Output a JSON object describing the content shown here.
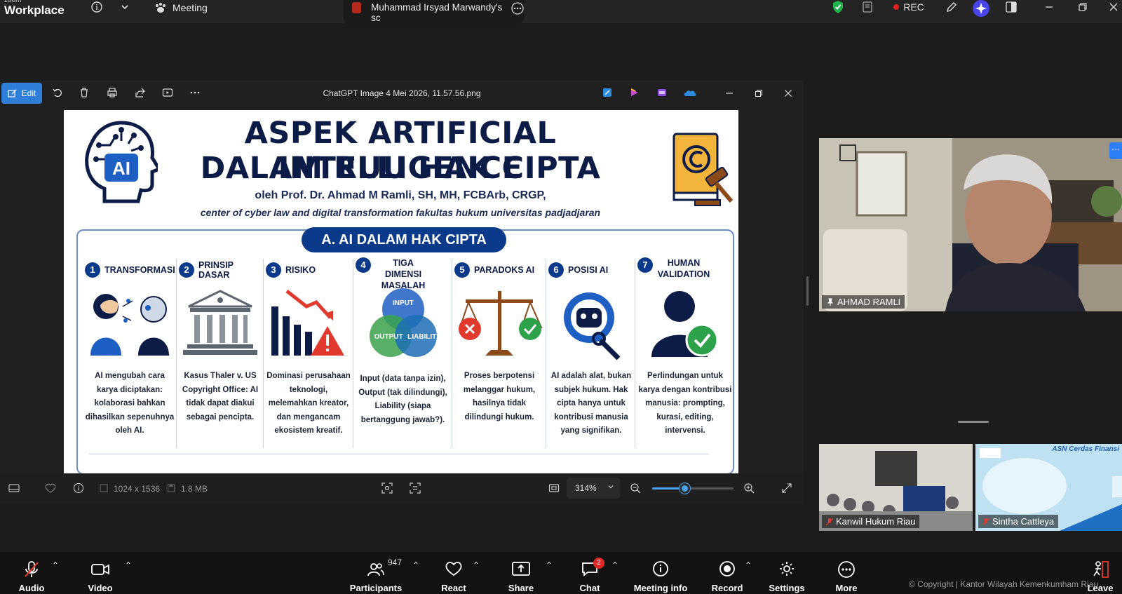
{
  "app": {
    "brand_small": "zoom",
    "brand_large": "Workplace"
  },
  "tabs": {
    "meeting": "Meeting",
    "share": "Muhammad Irsyad Marwandy's sc"
  },
  "status": {
    "rec": "REC"
  },
  "viewer": {
    "edit_label": "Edit",
    "file_title": "ChatGPT Image 4 Mei 2026, 11.57.56.png",
    "dimensions": "1024 x 1536",
    "file_size": "1.8 MB",
    "zoom": "314%",
    "zoom_slider_fraction": 0.4
  },
  "slide": {
    "title_line1": "ASPEK ARTIFICIAL INTELLIGENCE",
    "title_line2": "DALAM RUU HAK CIPTA",
    "ai_badge": "AI",
    "byline": "oleh Prof. Dr. Ahmad M Ramli, SH, MH, FCBArb, CRGP,",
    "affiliation": "center of cyber law and digital transformation fakultas hukum universitas padjadjaran",
    "section": "A. AI DALAM HAK CIPTA",
    "venn": {
      "top": "INPUT",
      "left": "OUTPUT",
      "right": "LIABILITY"
    },
    "columns": [
      {
        "num": "1",
        "title": "TRANSFORMASI",
        "body": "AI mengubah cara karya diciptakan: kolaborasi bahkan dihasilkan sepenuhnya oleh AI."
      },
      {
        "num": "2",
        "title": "PRINSIP DASAR",
        "body": "Kasus Thaler v. US Copyright Office: AI tidak dapat diakui sebagai pencipta."
      },
      {
        "num": "3",
        "title": "RISIKO",
        "body": "Dominasi perusahaan teknologi, melemahkan kreator, dan mengancam ekosistem kreatif."
      },
      {
        "num": "4",
        "title": "TIGA DIMENSI MASALAH",
        "body": "Input (data tanpa izin), Output (tak dilindungi), Liability (siapa bertanggung jawab?)."
      },
      {
        "num": "5",
        "title": "PARADOKS AI",
        "body": "Proses berpotensi melanggar hukum, hasilnya tidak dilindungi hukum."
      },
      {
        "num": "6",
        "title": "POSISI AI",
        "body": "AI adalah alat, bukan subjek hukum. Hak cipta hanya untuk kontribusi manusia yang signifikan."
      },
      {
        "num": "7",
        "title": "HUMAN VALIDATION",
        "body": "Perlindungan untuk karya dengan kontribusi manusia: prompting, kurasi, editing, intervensi."
      }
    ]
  },
  "participants_tiles": {
    "main": "AHMAD RAMLI",
    "tile1": "Kanwil Hukum Riau",
    "tile2": "Sintha Cattleya",
    "tile2_banner": "ASN Cerdas Finansi"
  },
  "toolbar": {
    "audio": "Audio",
    "video": "Video",
    "participants": "Participants",
    "participants_count": "947",
    "react": "React",
    "share": "Share",
    "chat": "Chat",
    "chat_badge": "2",
    "meeting_info": "Meeting info",
    "record": "Record",
    "settings": "Settings",
    "more": "More",
    "leave": "Leave"
  },
  "footer": {
    "copyright": "© Copyright | Kantor Wilayah Kemenkumham Riau"
  }
}
